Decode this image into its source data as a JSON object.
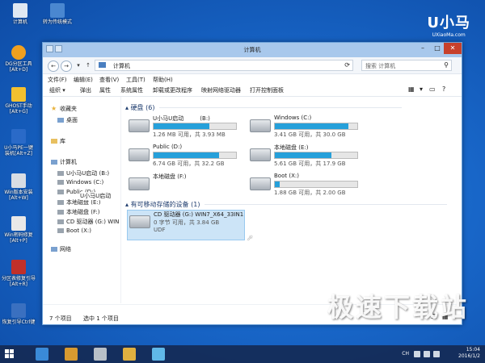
{
  "desktop": {
    "icons": [
      {
        "label": "计算机",
        "color": "#dfe8f2"
      },
      {
        "label": "转为传统模式",
        "color": "#4a87d0"
      },
      {
        "label": "DG分区工具\n[Alt+D]",
        "color": "#f0a020"
      },
      {
        "label": "GHOST手动\n[Alt+G]",
        "color": "#f2c030"
      },
      {
        "label": "U小马PE一键\n装机[Alt+Z]",
        "color": "#2a6ac8"
      },
      {
        "label": "Win版本安装\n[Alt+W]",
        "color": "#d8dde4"
      },
      {
        "label": "Win密码修复\n[Alt+P]",
        "color": "#e8e8e8"
      },
      {
        "label": "分区表修复引导\n[Alt+R]",
        "color": "#c0302a"
      },
      {
        "label": "恢复引导Ctrl键",
        "color": "#3a70c0"
      }
    ],
    "brand_title": "U小马",
    "brand_url": "UXiaoMa.com",
    "watermark": "极速下载站"
  },
  "window": {
    "title": "计算机",
    "address": [
      "计算机"
    ],
    "search_placeholder": "搜索 计算机",
    "menu": [
      "文件(F)",
      "编辑(E)",
      "查看(V)",
      "工具(T)",
      "帮助(H)"
    ],
    "toolbar": [
      "组织 ▾",
      "弹出",
      "属性",
      "系统属性",
      "卸载或更改程序",
      "映射网络驱动器",
      "打开控制面板"
    ]
  },
  "nav": {
    "items": [
      {
        "label": "收藏夹",
        "type": "fav"
      },
      {
        "label": "桌面",
        "type": "folder"
      },
      {
        "label": "库",
        "type": "folder"
      },
      {
        "label": "计算机",
        "type": "pc"
      },
      {
        "label": "U小马U启动 (B:)",
        "type": "drive"
      },
      {
        "label": "Windows (C:)",
        "type": "drive"
      },
      {
        "label": "Public (D:)",
        "type": "drive"
      },
      {
        "label": "本地磁盘 (E:)",
        "type": "drive"
      },
      {
        "label": "本地磁盘 (F:)",
        "type": "drive"
      },
      {
        "label": "CD 驱动器 (G:) WIN",
        "type": "drive"
      },
      {
        "label": "Boot (X:)",
        "type": "drive"
      },
      {
        "label": "网络",
        "type": "network"
      }
    ],
    "overlay_label": "U小马U启动"
  },
  "groups": {
    "hdd_header": "硬盘 (6)",
    "removable_header": "有可移动存储的设备 (1)"
  },
  "drives": [
    {
      "name": "U小马U启动",
      "letter": "(B:)",
      "free": "1.26 MB 可用，共 3.93 MB",
      "used": 0.68
    },
    {
      "name": "Windows (C:)",
      "letter": "",
      "free": "3.41 GB 可用，共 30.0 GB",
      "used": 0.89
    },
    {
      "name": "Public (D:)",
      "letter": "",
      "free": "6.74 GB 可用，共 32.2 GB",
      "used": 0.79
    },
    {
      "name": "本地磁盘 (E:)",
      "letter": "",
      "free": "5.61 GB 可用，共 17.9 GB",
      "used": 0.69
    },
    {
      "name": "本地磁盘 (F:)",
      "letter": "",
      "free": "",
      "used": null
    },
    {
      "name": "Boot (X:)",
      "letter": "",
      "free": "1.88 GB 可用，共 2.00 GB",
      "used": 0.06
    }
  ],
  "cd": {
    "name": "CD 驱动器 (G:) WIN7_X64_33IN1",
    "free": "0 字节 可用，共 3.84 GB",
    "fs": "UDF"
  },
  "status": {
    "count": "7 个项目",
    "selected": "选中 1 个项目"
  },
  "taskbar": {
    "icons": [
      {
        "name": "sync-icon",
        "color": "#3a8ad8"
      },
      {
        "name": "tools-icon",
        "color": "#d89a30"
      },
      {
        "name": "drive-icon",
        "color": "#b8c0c8"
      },
      {
        "name": "settings-icon",
        "color": "#e0b040"
      },
      {
        "name": "window-icon",
        "color": "#60b8e8"
      }
    ],
    "ch_label": "CH",
    "time": "15:04",
    "date": "2016/1/2"
  }
}
